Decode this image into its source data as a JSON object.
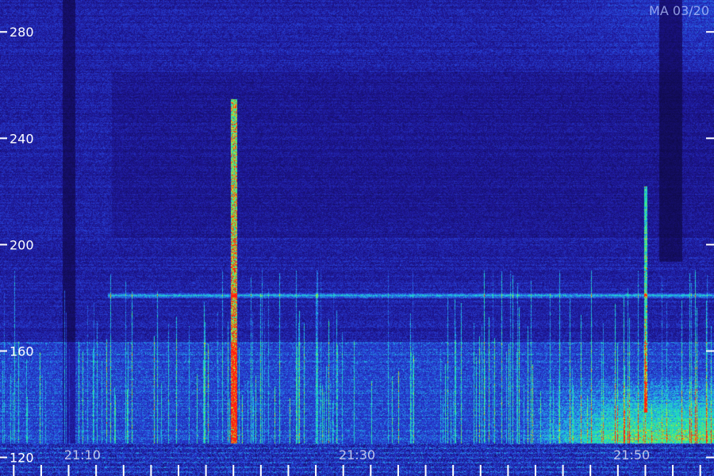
{
  "stamp": "MA 03/20",
  "chart_data": {
    "type": "heatmap",
    "title": "",
    "xlabel": "",
    "ylabel": "",
    "ylim": [
      113,
      292
    ],
    "y_ticks": [
      120,
      160,
      200,
      240,
      280
    ],
    "y_tick_labels": [
      "120",
      "160",
      "200",
      "240",
      "280"
    ],
    "xlim": [
      "21:04",
      "21:56"
    ],
    "x_ticks": [
      "21:10",
      "21:30",
      "21:50"
    ],
    "colors": {
      "background": "#140f6e",
      "dark_band": "#0a0630",
      "noise_blue": "#2d2ab8",
      "cyan": "#21c2e6",
      "green": "#26f090",
      "yellow": "#d8e020",
      "red": "#ff2010",
      "axis": "#ffffff"
    },
    "features": {
      "horizontal_line_y": 181,
      "bright_region": {
        "x_from": "21:45",
        "x_to": "21:56",
        "y_from": 113,
        "y_to": 140
      },
      "strong_burst": {
        "x": "21:21",
        "y_from": 125,
        "y_to": 255
      },
      "burst_column_2": {
        "x": "21:51",
        "y_from": 125,
        "y_to": 222
      }
    }
  }
}
